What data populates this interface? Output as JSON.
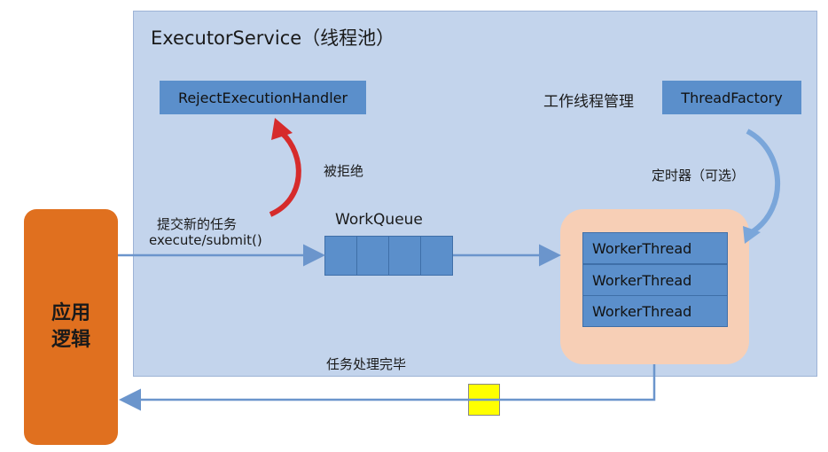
{
  "title": "ExecutorService（线程池）",
  "reject_handler": "RejectExecutionHandler",
  "thread_factory": "ThreadFactory",
  "worker_mgmt_label": "工作线程管理",
  "rejected_label": "被拒绝",
  "timer_label": "定时器（可选）",
  "submit_label_cn": "提交新的任务",
  "submit_label_code": "execute/submit()",
  "workqueue_label": "WorkQueue",
  "worker_threads": [
    "WorkerThread",
    "WorkerThread",
    "WorkerThread"
  ],
  "task_done_label": "任务处理完毕",
  "app_logic": [
    "应用",
    "逻辑"
  ],
  "colors": {
    "pool_bg": "#c3d4ec",
    "box_blue": "#5b8fcb",
    "app_orange": "#e0701f",
    "worker_pool_bg": "#f7cfb6",
    "token_yellow": "#ffff00",
    "reject_arrow": "#d62b2b",
    "flow_arrow": "#6b95cc"
  }
}
